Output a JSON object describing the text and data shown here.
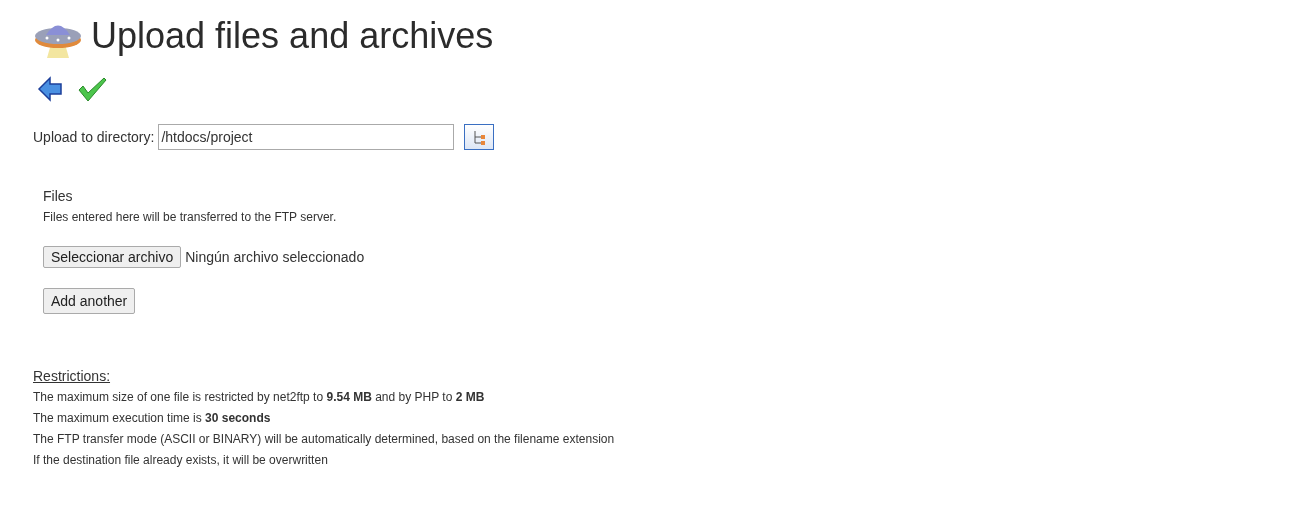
{
  "title": "Upload files and archives",
  "directory": {
    "label": "Upload to directory:",
    "value": "/htdocs/project"
  },
  "files": {
    "heading": "Files",
    "description": "Files entered here will be transferred to the FTP server.",
    "choose_button": "Seleccionar archivo",
    "choose_status": "Ningún archivo seleccionado",
    "add_button": "Add another"
  },
  "restrictions": {
    "heading": "Restrictions:",
    "lines": [
      "The maximum size of one file is restricted by net2ftp to **9.54 MB** and by PHP to **2 MB**",
      "The maximum execution time is **30 seconds**",
      "The FTP transfer mode (ASCII or BINARY) will be automatically determined, based on the filename extension",
      "If the destination file already exists, it will be overwritten"
    ]
  }
}
